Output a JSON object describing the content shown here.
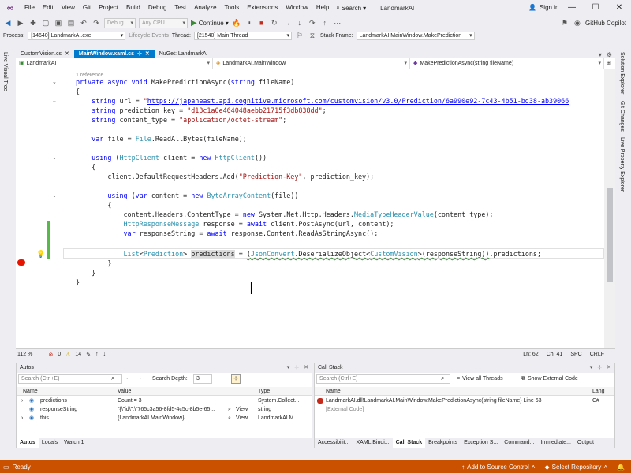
{
  "titlebar": {
    "menu": [
      "File",
      "Edit",
      "View",
      "Git",
      "Project",
      "Build",
      "Debug",
      "Test",
      "Analyze",
      "Tools",
      "Extensions",
      "Window",
      "Help"
    ],
    "search_label": "Search",
    "app_title": "LandmarkAI",
    "signin": "Sign in"
  },
  "toolbar": {
    "config": "Debug",
    "platform": "Any CPU",
    "continue_label": "Continue",
    "copilot": "GitHub Copilot"
  },
  "debugbar": {
    "process_label": "Process:",
    "process_value": "[14640] LandmarkAI.exe",
    "lifecycle_label": "Lifecycle Events",
    "thread_label": "Thread:",
    "thread_value": "[21540] Main Thread",
    "stackframe_label": "Stack Frame:",
    "stackframe_value": "LandmarkAI.MainWindow.MakePrediction"
  },
  "side": {
    "left_tab": "Live Visual Tree",
    "right_tabs": [
      "Solution Explorer",
      "Git Changes",
      "Live Property Explorer"
    ]
  },
  "doctabs": [
    {
      "label": "CustomVision.cs",
      "active": false
    },
    {
      "label": "MainWindow.xaml.cs",
      "active": true
    },
    {
      "label": "NuGet: LandmarkAI",
      "active": false
    }
  ],
  "navbar": {
    "project": "LandmarkAI",
    "class": "LandmarkAI.MainWindow",
    "member": "MakePredictionAsync(string fileName)"
  },
  "code": {
    "references": "1 reference",
    "url_value": "https://japaneast.api.cognitive.microsoft.com/customvision/v3.0/Prediction/6a990e92-7c43-4b51-bd38-ab39066",
    "prediction_key": "\"d13c1a0e464048aebb21715f3db838dd\"",
    "content_type": "\"application/octet-stream\"",
    "header_name": "\"Prediction-Key\""
  },
  "editor_status": {
    "zoom": "112 %",
    "errors": "0",
    "warnings": "14",
    "line": "Ln: 62",
    "col": "Ch: 41",
    "spc": "SPC",
    "crlf": "CRLF"
  },
  "autos": {
    "title": "Autos",
    "search_placeholder": "Search (Ctrl+E)",
    "depth_label": "Search Depth:",
    "depth_value": "3",
    "columns": [
      "Name",
      "Value",
      "Type"
    ],
    "rows": [
      {
        "name": "predictions",
        "value": "Count = 3",
        "view": "",
        "type": "System.Collect..."
      },
      {
        "name": "responseString",
        "value": "\"{\\\"id\\\":\\\"765c3a56-8fd5-4c5c-8b5e-65...",
        "view": "View",
        "type": "string"
      },
      {
        "name": "this",
        "value": "{LandmarkAI.MainWindow}",
        "view": "View",
        "type": "LandmarkAI.M..."
      }
    ],
    "tabs": [
      "Autos",
      "Locals",
      "Watch 1"
    ]
  },
  "callstack": {
    "title": "Call Stack",
    "search_placeholder": "Search (Ctrl+E)",
    "view_threads": "View all Threads",
    "show_external": "Show External Code",
    "columns": [
      "Name",
      "Lang"
    ],
    "rows": [
      {
        "name": "LandmarkAI.dll!LandmarkAI.MainWindow.MakePredictionAsync(string fileName) Line 63",
        "lang": "C#"
      },
      {
        "name": "[External Code]",
        "lang": ""
      }
    ],
    "tabs": [
      "Accessibilit...",
      "XAML Bindi...",
      "Call Stack",
      "Breakpoints",
      "Exception S...",
      "Command...",
      "Immediate...",
      "Output"
    ]
  },
  "statusbar": {
    "ready": "Ready",
    "source_control": "Add to Source Control",
    "repository": "Select Repository"
  }
}
